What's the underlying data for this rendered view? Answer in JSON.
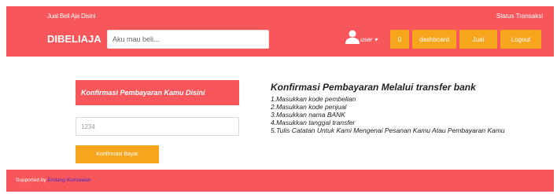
{
  "header": {
    "tagline": "Jual Beli Aja Disini",
    "status_link": "Status Transaksi",
    "brand": "DIBELIAJA",
    "search_placeholder": "Aku mau beli...",
    "user_label": "user ▾",
    "cart_count": "0",
    "dashboard_label": "dashboard",
    "jual_label": "Jual",
    "logout_label": "Logout"
  },
  "left_panel": {
    "title": "Konfirmasi Pembayaran Kamu Disini",
    "code_placeholder": "1234",
    "confirm_button": "Konfirmasi Bayar"
  },
  "instructions": {
    "title": "Konfirmasi Pembayaran Melalui transfer bank",
    "steps": [
      "1.Masukkan kode pembelian",
      "2.Masukkan kode penjual",
      "3.Masukkan nama BANK",
      "4.Masukkan tanggal transfer",
      "5.Tulis Catatan Untuk Kami Mengenai Pesanan Kamu Atau Pembayaran Kamu"
    ]
  },
  "footer": {
    "supported_by": "Supported by",
    "author": "Endang Kurniawan"
  },
  "colors": {
    "primary": "#f7565a",
    "accent": "#f7a51c"
  }
}
